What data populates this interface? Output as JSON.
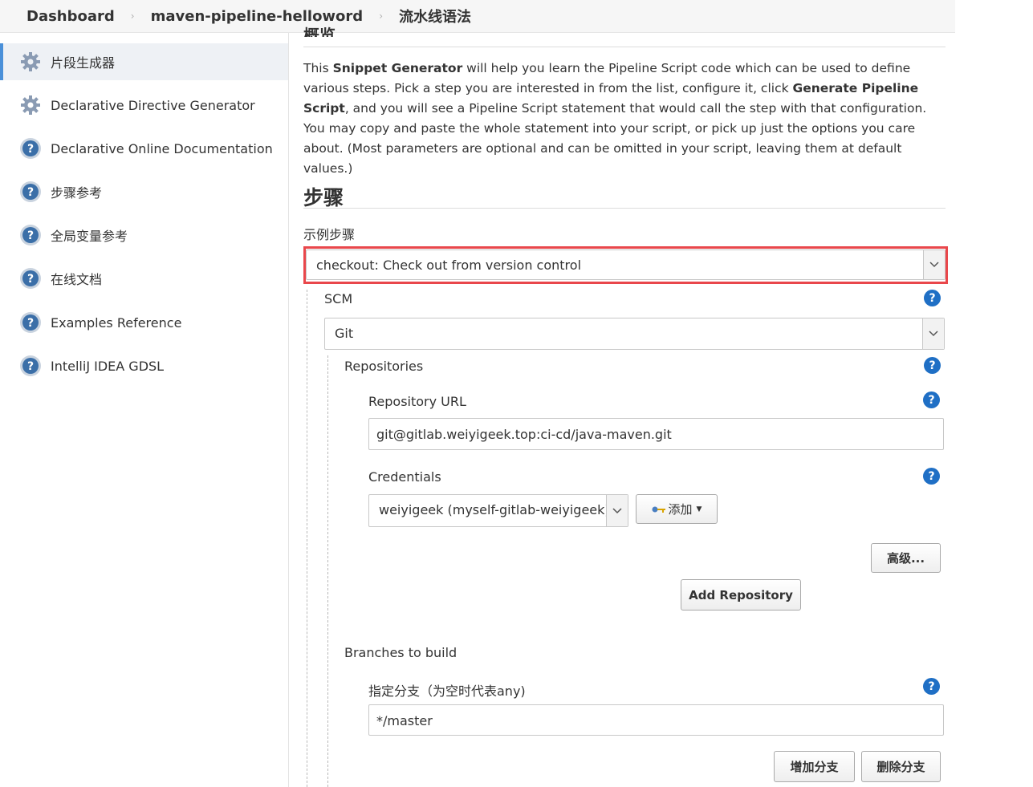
{
  "breadcrumb": {
    "items": [
      "Dashboard",
      "maven-pipeline-helloword",
      "流水线语法"
    ]
  },
  "sidebar": {
    "items": [
      {
        "label": "片段生成器",
        "icon": "gear-icon",
        "active": true
      },
      {
        "label": "Declarative Directive Generator",
        "icon": "gear-icon",
        "active": false
      },
      {
        "label": "Declarative Online Documentation",
        "icon": "help-icon",
        "active": false
      },
      {
        "label": "步骤参考",
        "icon": "help-icon",
        "active": false
      },
      {
        "label": "全局变量参考",
        "icon": "help-icon",
        "active": false
      },
      {
        "label": "在线文档",
        "icon": "help-icon",
        "active": false
      },
      {
        "label": "Examples Reference",
        "icon": "help-icon",
        "active": false
      },
      {
        "label": "IntelliJ IDEA GDSL",
        "icon": "help-icon",
        "active": false
      }
    ]
  },
  "main": {
    "cut_heading": "概览",
    "intro": {
      "p1": "This ",
      "b1": "Snippet Generator",
      "p2": " will help you learn the Pipeline Script code which can be used to define various steps. Pick a step you are interested in from the list, configure it, click ",
      "b2": "Generate Pipeline Script",
      "p3": ", and you will see a Pipeline Script statement that would call the step with that configuration. You may copy and paste the whole statement into your script, or pick up just the options you care about. (Most parameters are optional and can be omitted in your script, leaving them at default values.)"
    },
    "steps_title": "步骤",
    "sample_step_label": "示例步骤",
    "sample_step_value": "checkout: Check out from version control",
    "scm_label": "SCM",
    "scm_value": "Git",
    "repositories_label": "Repositories",
    "repo_url_label": "Repository URL",
    "repo_url_value": "git@gitlab.weiyigeek.top:ci-cd/java-maven.git",
    "credentials_label": "Credentials",
    "credentials_value": "weiyigeek (myself-gitlab-weiyigeek)",
    "add_button": "添加",
    "advanced_button": "高级...",
    "add_repository_button": "Add Repository",
    "branches_label": "Branches to build",
    "branch_spec_label": "指定分支（为空时代表any)",
    "branch_spec_value": "*/master",
    "add_branch_button": "增加分支",
    "delete_branch_button": "删除分支",
    "help_glyph": "?"
  },
  "colors": {
    "highlight": "#e9474b",
    "help_icon": "#1f6fc5",
    "active_sidebar_bg": "#eef1f5"
  }
}
